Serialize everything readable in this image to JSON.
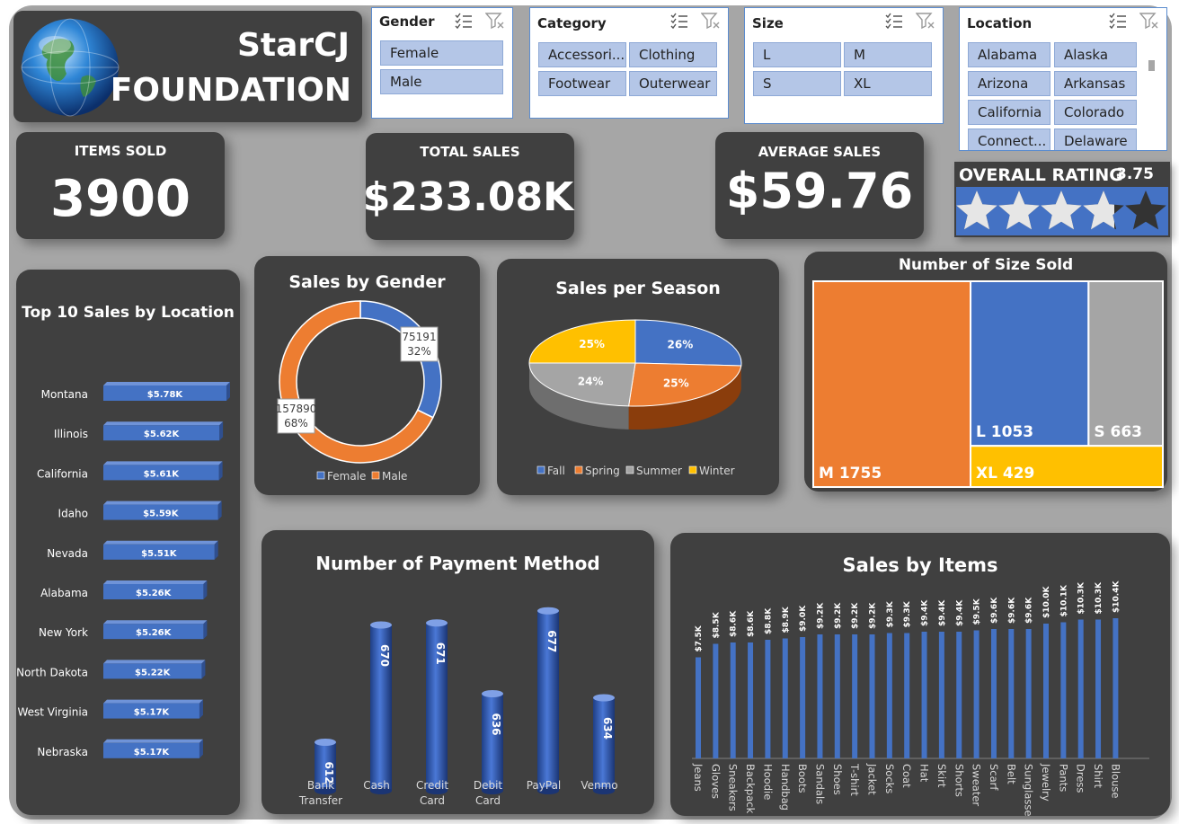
{
  "brand": {
    "line1": "StarCJ",
    "line2": "FOUNDATION",
    "globe_icon": "globe-icon"
  },
  "slicers": {
    "gender": {
      "title": "Gender",
      "items": [
        "Female",
        "Male"
      ]
    },
    "category": {
      "title": "Category",
      "items": [
        "Accessori...",
        "Clothing",
        "Footwear",
        "Outerwear"
      ]
    },
    "size": {
      "title": "Size",
      "items": [
        "L",
        "M",
        "S",
        "XL"
      ]
    },
    "location": {
      "title": "Location",
      "items": [
        "Alabama",
        "Alaska",
        "Arizona",
        "Arkansas",
        "California",
        "Colorado",
        "Connect...",
        "Delaware"
      ]
    }
  },
  "kpis": {
    "items_sold": {
      "label": "ITEMS SOLD",
      "value": "3900"
    },
    "total_sales": {
      "label": "TOTAL SALES",
      "value": "$233.08K"
    },
    "average_sales": {
      "label": "AVERAGE SALES",
      "value": "$59.76"
    }
  },
  "rating": {
    "label": "OVERALL RATING",
    "value": "3.75",
    "max": 5,
    "score": 3.75,
    "star_color": "#e6e6e6",
    "panel_color": "#4472c4"
  },
  "colors": {
    "blue": "#4472c4",
    "orange": "#ed7d31",
    "gray": "#a5a5a5",
    "gold": "#ffc000",
    "card": "#404040"
  },
  "chart_data": [
    {
      "type": "bar",
      "orientation": "horizontal",
      "title": "Top 10  Sales by Location",
      "categories": [
        "Montana",
        "Illinois",
        "California",
        "Idaho",
        "Nevada",
        "Alabama",
        "New York",
        "North Dakota",
        "West Virginia",
        "Nebraska"
      ],
      "values": [
        5.78,
        5.62,
        5.61,
        5.59,
        5.51,
        5.26,
        5.26,
        5.22,
        5.17,
        5.17
      ],
      "labels": [
        "$5.78K",
        "$5.62K",
        "$5.61K",
        "$5.59K",
        "$5.51K",
        "$5.26K",
        "$5.26K",
        "$5.22K",
        "$5.17K",
        "$5.17K"
      ],
      "unit": "K$"
    },
    {
      "type": "pie",
      "variant": "donut",
      "title": "Sales by Gender",
      "categories": [
        "Female",
        "Male"
      ],
      "values": [
        75191,
        157890
      ],
      "percent_labels": [
        "32%",
        "68%"
      ],
      "value_labels": [
        "75191",
        "157890"
      ],
      "legend": [
        "Female",
        "Male"
      ]
    },
    {
      "type": "pie",
      "variant": "3d",
      "title": "Sales per Season",
      "categories": [
        "Fall",
        "Spring",
        "Summer",
        "Winter"
      ],
      "values": [
        26,
        25,
        24,
        25
      ],
      "labels": [
        "26%",
        "25%",
        "24%",
        "25%"
      ],
      "legend": [
        "Fall",
        "Spring",
        "Summer",
        "Winter"
      ]
    },
    {
      "type": "heatmap",
      "variant": "treemap",
      "title": "Number of Size Sold",
      "categories": [
        "M",
        "L",
        "S",
        "XL"
      ],
      "values": [
        1755,
        1053,
        663,
        429
      ],
      "labels": [
        "M 1755",
        "L 1053",
        "S 663",
        "XL 429"
      ]
    },
    {
      "type": "bar",
      "variant": "3d-cylinder",
      "title": "Number of Payment Method",
      "categories": [
        "Bank Transfer",
        "Cash",
        "Credit Card",
        "Debit Card",
        "PayPal",
        "Venmo"
      ],
      "values": [
        612,
        670,
        671,
        636,
        677,
        634
      ],
      "labels": [
        "612",
        "670",
        "671",
        "636",
        "677",
        "634"
      ],
      "ylim": [
        600,
        680
      ]
    },
    {
      "type": "bar",
      "title": "Sales by Items",
      "categories": [
        "Jeans",
        "Gloves",
        "Sneakers",
        "Backpack",
        "Hoodie",
        "Handbag",
        "Boots",
        "Sandals",
        "Shoes",
        "T-shirt",
        "Jacket",
        "Socks",
        "Coat",
        "Hat",
        "Skirt",
        "Shorts",
        "Sweater",
        "Scarf",
        "Belt",
        "Sunglasses",
        "Jewelry",
        "Pants",
        "Dress",
        "Shirt",
        "Blouse"
      ],
      "values": [
        7.5,
        8.5,
        8.6,
        8.6,
        8.8,
        8.9,
        9.0,
        9.2,
        9.2,
        9.2,
        9.2,
        9.3,
        9.3,
        9.4,
        9.4,
        9.4,
        9.5,
        9.6,
        9.6,
        9.6,
        10.0,
        10.1,
        10.3,
        10.3,
        10.4
      ],
      "labels": [
        "$7.5K",
        "$8.5K",
        "$8.6K",
        "$8.6K",
        "$8.8K",
        "$8.9K",
        "$9.0K",
        "$9.2K",
        "$9.2K",
        "$9.2K",
        "$9.2K",
        "$9.3K",
        "$9.3K",
        "$9.4K",
        "$9.4K",
        "$9.4K",
        "$9.5K",
        "$9.6K",
        "$9.6K",
        "$9.6K",
        "$10.0K",
        "$10.1K",
        "$10.3K",
        "$10.3K",
        "$10.4K"
      ],
      "unit": "K$"
    }
  ]
}
